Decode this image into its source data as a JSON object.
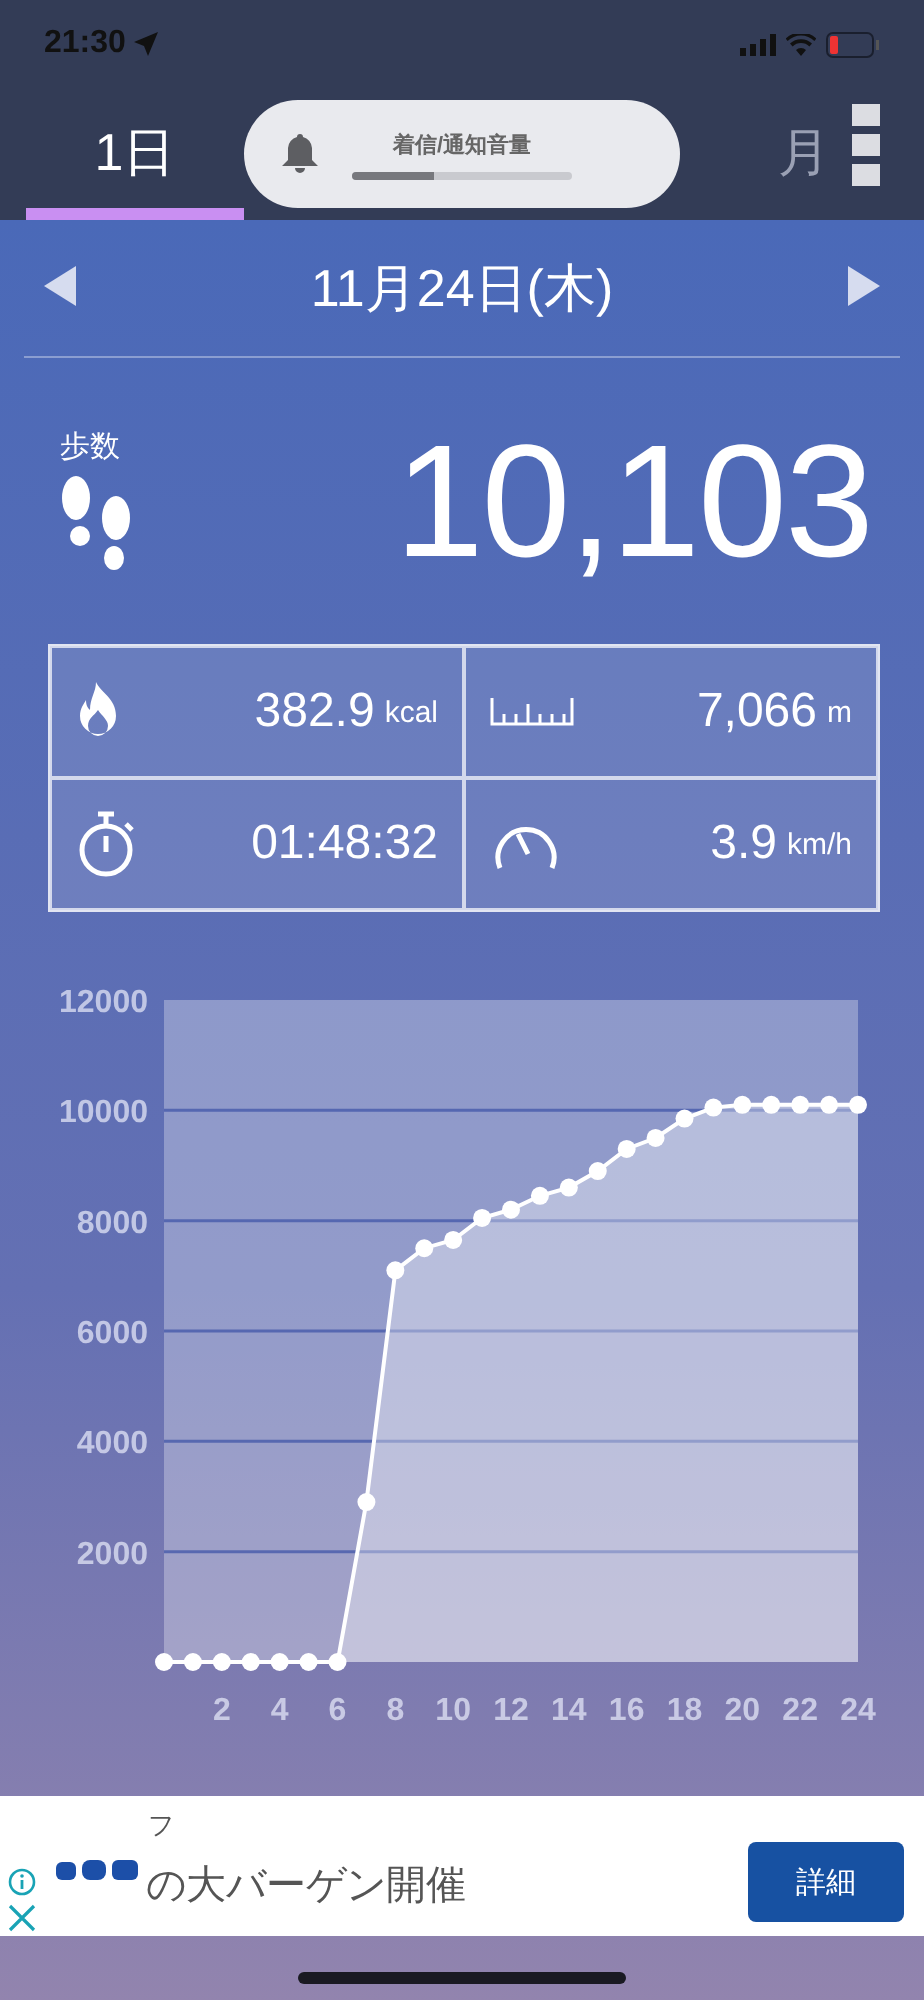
{
  "status_bar": {
    "time": "21:30"
  },
  "tabs": [
    {
      "label": "1日",
      "selected": true
    },
    {
      "label": "月",
      "selected": false
    }
  ],
  "volume_hud": {
    "title": "着信/通知音量",
    "level": 0.37
  },
  "date_nav": {
    "date": "11月24日(木)"
  },
  "steps": {
    "label": "歩数",
    "value": "10,103"
  },
  "stats": [
    {
      "kind": "calories",
      "value": "382.9",
      "unit": "kcal"
    },
    {
      "kind": "distance",
      "value": "7,066",
      "unit": "m"
    },
    {
      "kind": "duration",
      "value": "01:48:32"
    },
    {
      "kind": "speed",
      "value": "3.9",
      "unit": "km/h"
    }
  ],
  "chart_data": {
    "type": "line",
    "x": [
      0,
      1,
      2,
      3,
      4,
      5,
      6,
      7,
      8,
      9,
      10,
      11,
      12,
      13,
      14,
      15,
      16,
      17,
      18,
      19,
      20,
      21,
      22,
      23,
      24
    ],
    "series": [
      {
        "color": "#ffffff",
        "marker": true,
        "values": [
          0,
          0,
          0,
          0,
          0,
          0,
          0,
          2900,
          7100,
          7500,
          7650,
          8050,
          8200,
          8450,
          8600,
          8900,
          9300,
          9500,
          9850,
          10050,
          10100,
          10100,
          10100,
          10100,
          10100
        ]
      }
    ],
    "grid": true,
    "xlim": [
      0,
      24
    ],
    "ylim": [
      0,
      12000
    ],
    "xticks": [
      2,
      4,
      6,
      8,
      10,
      12,
      14,
      16,
      18,
      20,
      22,
      24
    ],
    "yticks": [
      2000,
      4000,
      6000,
      8000,
      10000,
      12000
    ]
  },
  "ad": {
    "small_text": "フ",
    "headline": "の大バーゲン開催",
    "button": "詳細"
  }
}
